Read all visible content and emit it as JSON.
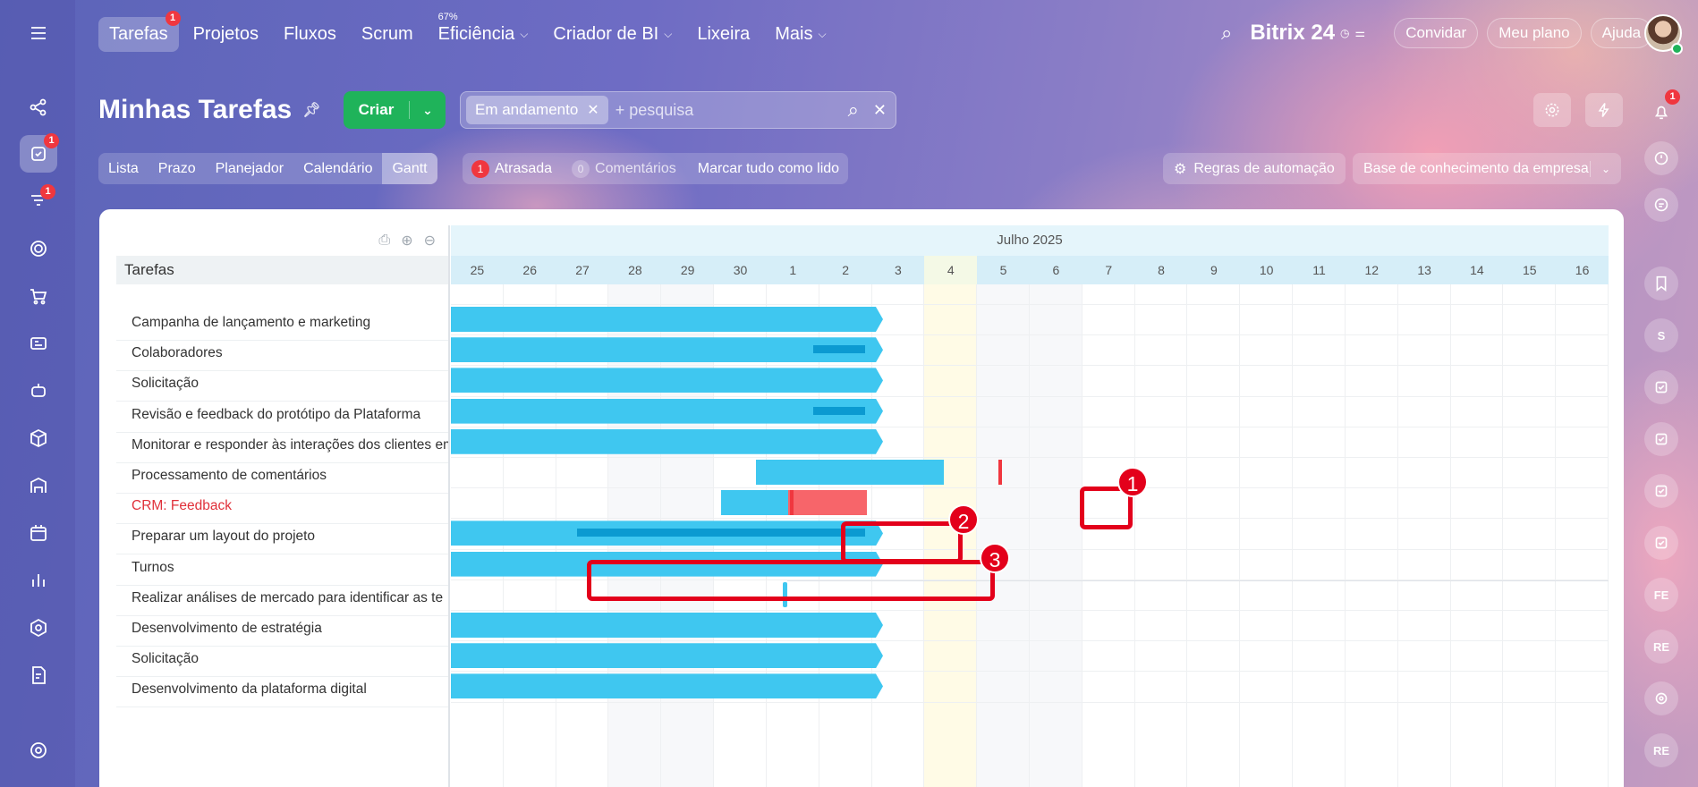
{
  "topnav": {
    "items": [
      {
        "label": "Tarefas",
        "badge": "1",
        "active": true
      },
      {
        "label": "Projetos"
      },
      {
        "label": "Fluxos"
      },
      {
        "label": "Scrum"
      },
      {
        "label": "Eficiência",
        "small": "67%",
        "dropdown": true
      },
      {
        "label": "Criador de BI",
        "dropdown": true
      },
      {
        "label": "Lixeira"
      },
      {
        "label": "Mais",
        "dropdown": true
      }
    ],
    "logo": "Bitrix 24",
    "invite": "Convidar",
    "plan": "Meu plano",
    "help": "Ajuda"
  },
  "leftbar_badges": {
    "tasks": "1",
    "feed": "1"
  },
  "notifications_badge": "1",
  "page": {
    "title": "Minhas Tarefas",
    "create": "Criar"
  },
  "search": {
    "chip": "Em andamento",
    "placeholder": "+ pesquisa"
  },
  "views": [
    "Lista",
    "Prazo",
    "Planejador",
    "Calendário",
    "Gantt"
  ],
  "active_view": "Gantt",
  "counters": {
    "overdue_count": "1",
    "overdue_label": "Atrasada",
    "comments_count": "0",
    "comments_label": "Comentários",
    "mark_read": "Marcar tudo como lido"
  },
  "automation": "Regras de automação",
  "knowledge_base": "Base de conhecimento da empresa",
  "tasks_header": "Tarefas",
  "gantt": {
    "month": "Julho 2025",
    "days": [
      "25",
      "26",
      "27",
      "28",
      "29",
      "30",
      "1",
      "2",
      "3",
      "4",
      "5",
      "6",
      "7",
      "8",
      "9",
      "10",
      "11",
      "12",
      "13",
      "14",
      "15",
      "16"
    ],
    "today_index": 9,
    "weekend_indices": [
      3,
      4,
      10,
      11
    ]
  },
  "tasks": [
    {
      "name": "Campanha de lançamento e marketing"
    },
    {
      "name": "Colaboradores"
    },
    {
      "name": "Solicitação"
    },
    {
      "name": "Revisão e feedback do protótipo da Plataforma"
    },
    {
      "name": "Monitorar e responder às interações dos clientes em"
    },
    {
      "name": "Processamento de comentários"
    },
    {
      "name": "CRM: Feedback",
      "overdue": true
    },
    {
      "name": "Preparar um layout do projeto"
    },
    {
      "name": "Turnos"
    },
    {
      "name": "Realizar análises de mercado para identificar as te"
    },
    {
      "name": "Desenvolvimento de estratégia"
    },
    {
      "name": "Solicitação"
    },
    {
      "name": "Desenvolvimento da plataforma digital"
    }
  ],
  "markers": [
    "1",
    "2",
    "3"
  ],
  "rightbar_avatars": [
    "S",
    "FE",
    "RE",
    "RE"
  ],
  "colors": {
    "bar": "#3fc7f0",
    "progress": "#0b9ad1",
    "overdue": "#f7656a",
    "highlight": "#e3001b",
    "create": "#1fb35a"
  }
}
